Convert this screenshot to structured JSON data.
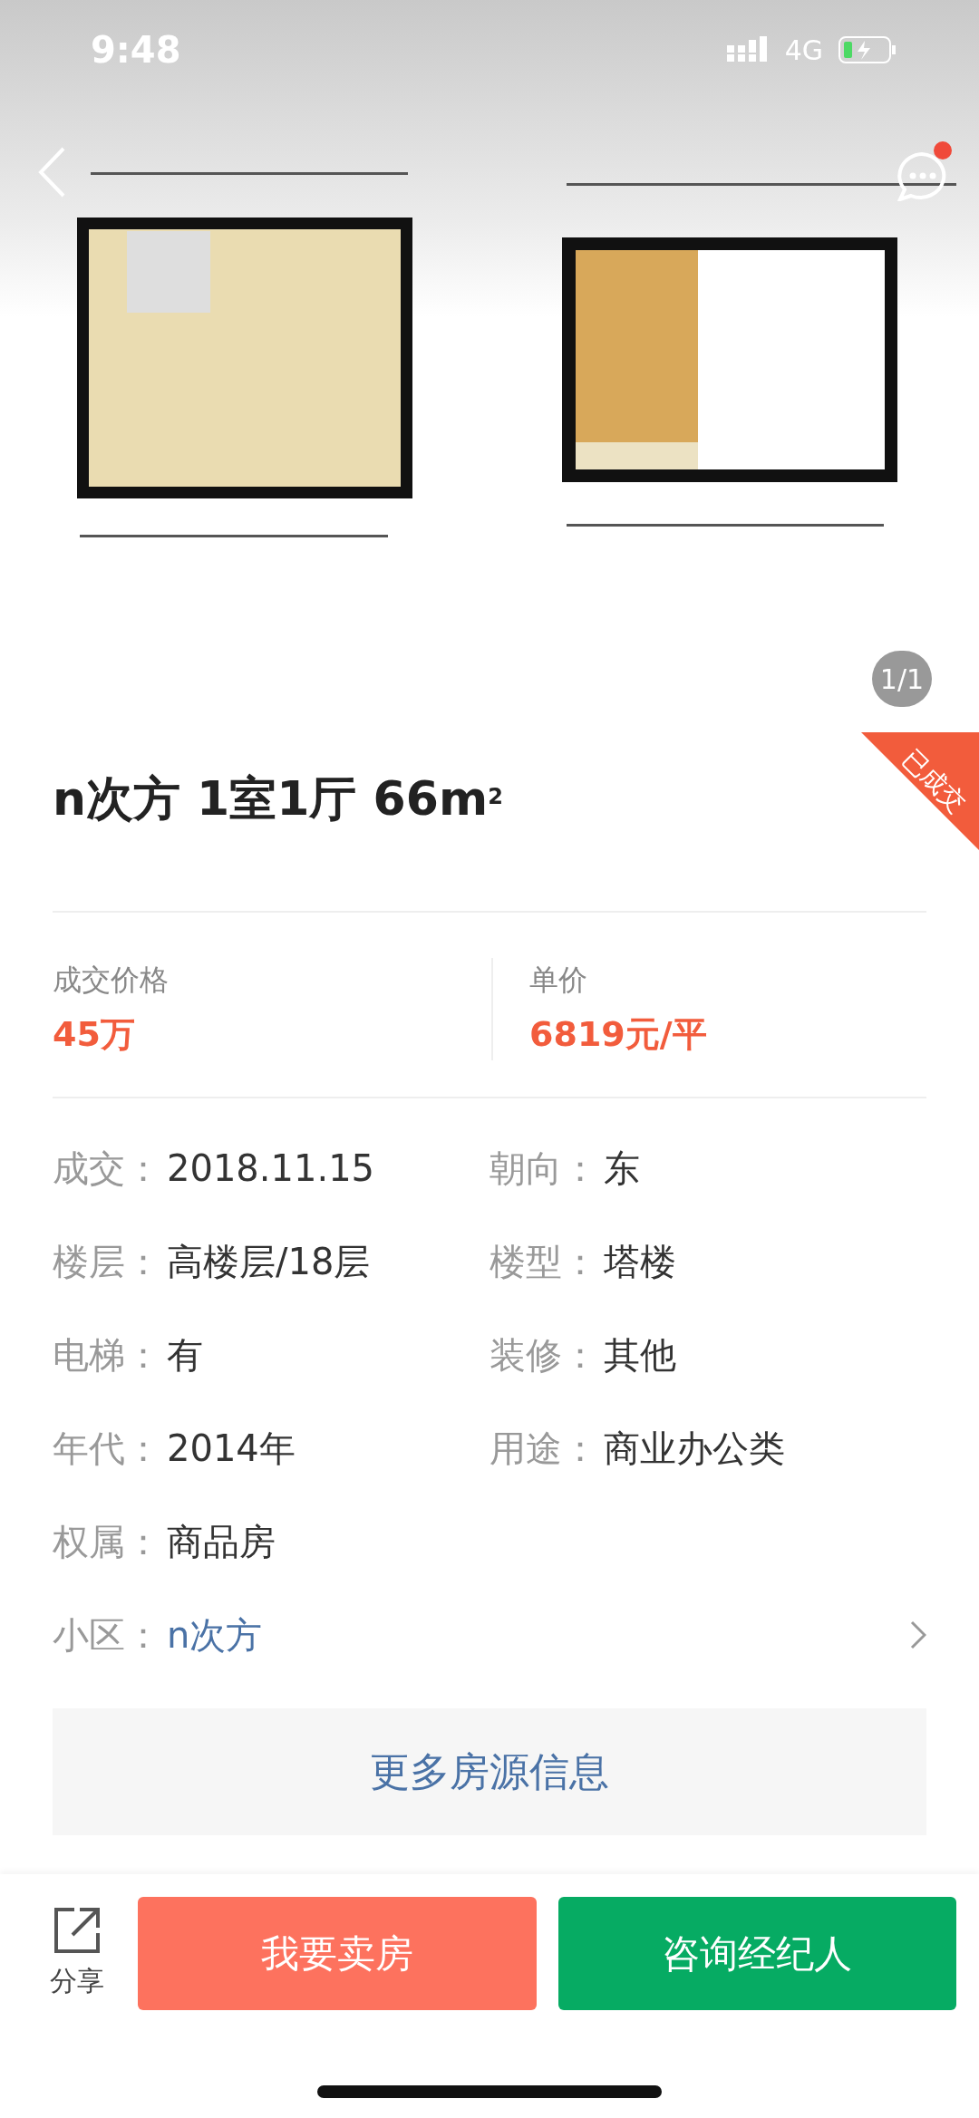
{
  "status_bar": {
    "time": "9:48",
    "network": "4G"
  },
  "header": {
    "has_unread": true
  },
  "gallery": {
    "pager": "1/1"
  },
  "sold_badge": "已成交",
  "title": "n次方 1室1厅 66m$^{2}$",
  "prices": [
    {
      "label": "成交价格",
      "value": "45万"
    },
    {
      "label": "单价",
      "value": "6819元/平"
    }
  ],
  "details": [
    {
      "label": "成交：",
      "value": "2018.11.15",
      "kind": "text"
    },
    {
      "label": "朝向：",
      "value": "东",
      "kind": "text"
    },
    {
      "label": "楼层：",
      "value": "高楼层/18层",
      "kind": "text"
    },
    {
      "label": "楼型：",
      "value": "塔楼",
      "kind": "text"
    },
    {
      "label": "电梯：",
      "value": "有",
      "kind": "text"
    },
    {
      "label": "装修：",
      "value": "其他",
      "kind": "text"
    },
    {
      "label": "年代：",
      "value": "2014年",
      "kind": "text"
    },
    {
      "label": "用途：",
      "value": "商业办公类",
      "kind": "text"
    },
    {
      "label": "权属：",
      "value": "商品房",
      "kind": "text"
    },
    {
      "label": "小区：",
      "value": "n次方",
      "kind": "link"
    }
  ],
  "more_button": "更多房源信息",
  "bottom_bar": {
    "share": "分享",
    "buttons": [
      {
        "label": "我要卖房",
        "kind": "sell"
      },
      {
        "label": "咨询经纪人",
        "kind": "agent"
      }
    ]
  }
}
